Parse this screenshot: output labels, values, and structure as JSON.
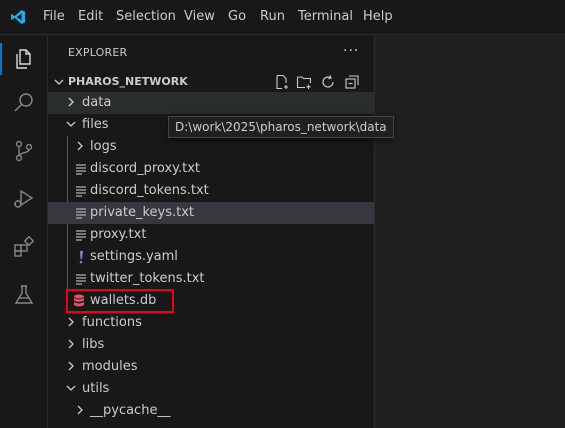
{
  "menu": [
    "File",
    "Edit",
    "Selection",
    "View",
    "Go",
    "Run",
    "Terminal",
    "Help"
  ],
  "activity_bar": [
    {
      "name": "explorer-icon",
      "active": true
    },
    {
      "name": "search-icon",
      "active": false
    },
    {
      "name": "source-control-icon",
      "active": false
    },
    {
      "name": "run-debug-icon",
      "active": false
    },
    {
      "name": "extensions-icon",
      "active": false
    },
    {
      "name": "testing-icon",
      "active": false
    }
  ],
  "explorer": {
    "title": "EXPLORER",
    "more": "···",
    "section_title": "PHAROS_NETWORK",
    "section_actions": [
      "new-file-icon",
      "new-folder-icon",
      "refresh-icon",
      "collapse-all-icon"
    ]
  },
  "tree": [
    {
      "label": "data",
      "type": "folder",
      "expanded": false
    },
    {
      "label": "files",
      "type": "folder",
      "expanded": true
    },
    {
      "label": "logs",
      "type": "folder",
      "expanded": false
    },
    {
      "label": "discord_proxy.txt",
      "type": "txt"
    },
    {
      "label": "discord_tokens.txt",
      "type": "txt"
    },
    {
      "label": "private_keys.txt",
      "type": "txt"
    },
    {
      "label": "proxy.txt",
      "type": "txt"
    },
    {
      "label": "settings.yaml",
      "type": "yaml"
    },
    {
      "label": "twitter_tokens.txt",
      "type": "txt"
    },
    {
      "label": "wallets.db",
      "type": "db"
    },
    {
      "label": "functions",
      "type": "folder",
      "expanded": false
    },
    {
      "label": "libs",
      "type": "folder",
      "expanded": false
    },
    {
      "label": "modules",
      "type": "folder",
      "expanded": false
    },
    {
      "label": "utils",
      "type": "folder",
      "expanded": true
    },
    {
      "label": "__pycache__",
      "type": "folder",
      "expanded": false
    }
  ],
  "tooltip": "D:\\work\\2025\\pharos_network\\data",
  "colors": {
    "accent": "#0078d4",
    "yaml_icon": "#a074c4",
    "db_icon": "#f14c6b",
    "highlight_box": "#e8001c"
  }
}
